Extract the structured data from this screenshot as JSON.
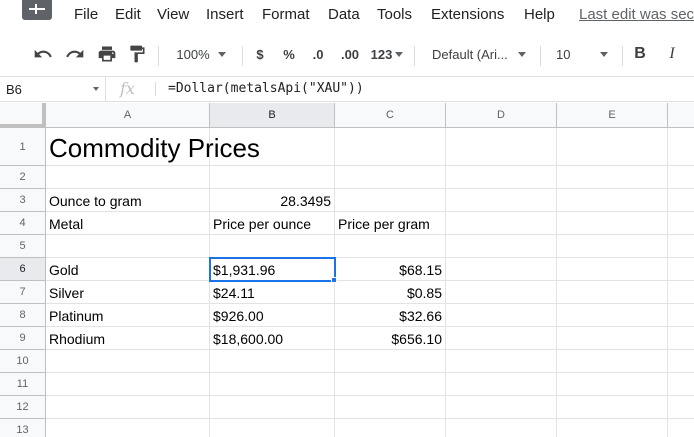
{
  "menu": {
    "items": [
      "File",
      "Edit",
      "View",
      "Insert",
      "Format",
      "Data",
      "Tools",
      "Extensions",
      "Help"
    ],
    "last_edit": "Last edit was sec"
  },
  "toolbar": {
    "zoom": "100%",
    "currency": "$",
    "percent": "%",
    "decrease_decimal": ".0",
    "increase_decimal": ".00",
    "more_formats": "123",
    "font": "Default (Ari...",
    "font_size": "10",
    "bold": "B",
    "italic": "I",
    "icons": [
      "undo-icon",
      "redo-icon",
      "print-icon",
      "paint-format-icon"
    ]
  },
  "formula_bar": {
    "cell_ref": "B6",
    "fx": "fx",
    "formula": "=Dollar(metalsApi(\"XAU\"))"
  },
  "sheet": {
    "columns": [
      "A",
      "B",
      "C",
      "D",
      "E"
    ],
    "rows": [
      "1",
      "2",
      "3",
      "4",
      "5",
      "6",
      "7",
      "8",
      "9",
      "10",
      "11",
      "12",
      "13"
    ],
    "selected_cell": "B6",
    "cells": {
      "A1": "Commodity Prices",
      "A3": "Ounce to gram",
      "B3": "28.3495",
      "A4": "Metal",
      "B4": "Price per ounce",
      "C4": "Price per gram",
      "A6": "Gold",
      "B6": "$1,931.96",
      "C6": "$68.15",
      "A7": "Silver",
      "B7": "$24.11",
      "C7": "$0.85",
      "A8": "Platinum",
      "B8": "$926.00",
      "C8": "$32.66",
      "A9": "Rhodium",
      "B9": "$18,600.00",
      "C9": "$656.10"
    }
  },
  "colors": {
    "selection": "#1a73e8",
    "header_bg": "#f8f9fa",
    "gridline": "#e2e3e3"
  }
}
